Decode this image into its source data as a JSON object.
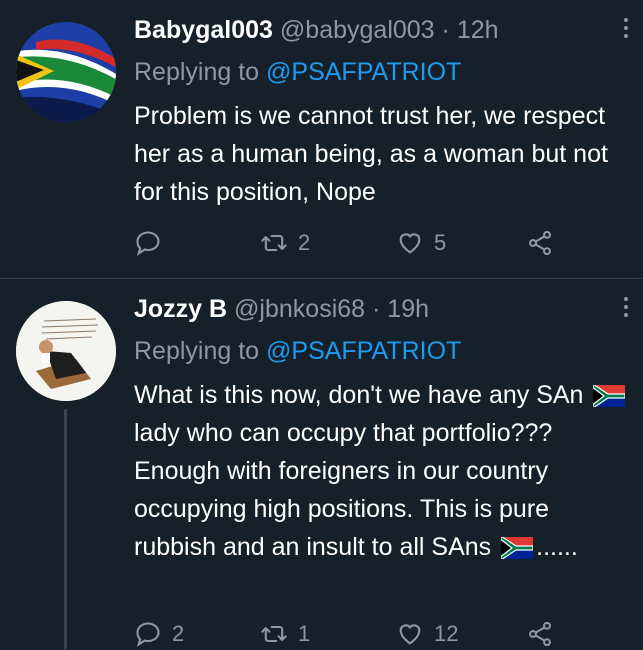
{
  "tweets": [
    {
      "name": "Babygal003",
      "handle": "@babygal003",
      "dot": "·",
      "time": "12h",
      "replying_label": "Replying to",
      "replying_to": "@PSAFPATRIOT",
      "body": "Problem is we cannot trust her, we respect her as a human being, as a woman but not for this position, Nope",
      "replies": "",
      "retweets": "2",
      "likes": "5"
    },
    {
      "name": "Jozzy B",
      "handle": "@jbnkosi68",
      "dot": "·",
      "time": "19h",
      "replying_label": "Replying to",
      "replying_to": "@PSAFPATRIOT",
      "body_a": "What is this now, don't we have any SAn",
      "body_b": "lady who can occupy that portfolio??? Enough with foreigners in our country occupying high positions. This is pure rubbish and an insult to all SAns",
      "body_c": "......",
      "flag_emoji": "south-africa-flag",
      "replies": "2",
      "retweets": "1",
      "likes": "12"
    }
  ],
  "colors": {
    "background": "#15202b",
    "text": "#ffffff",
    "muted": "#8b98a5",
    "link": "#1d9bf0",
    "divider": "#38444d"
  }
}
